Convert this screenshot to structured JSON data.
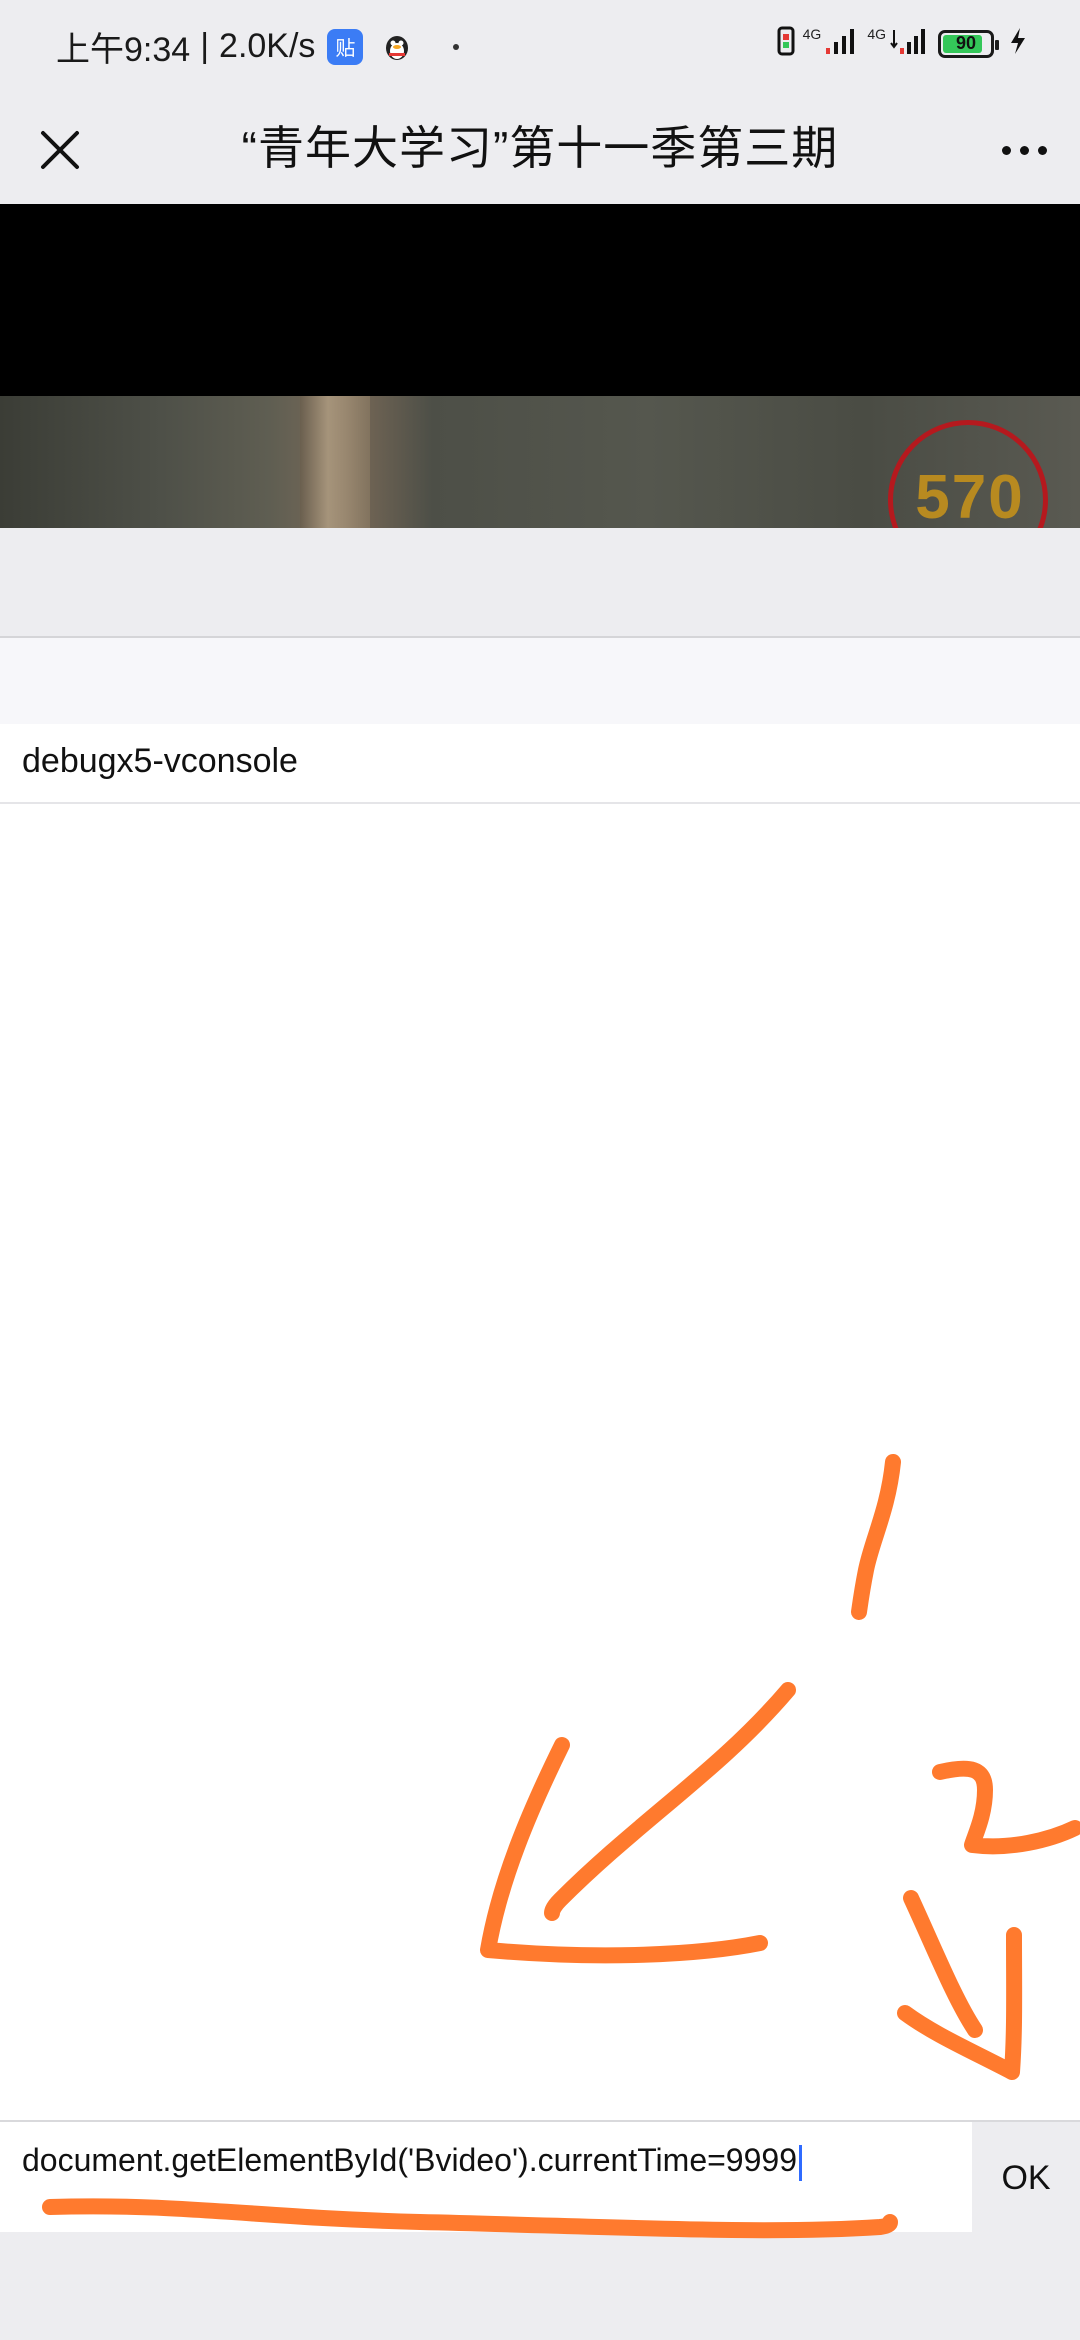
{
  "status_bar": {
    "time": "上午9:34",
    "separator": "|",
    "network_speed": "2.0K/s",
    "app_badge_char": "贴",
    "signal_1_label": "4G",
    "signal_2_label": "4G",
    "battery_percent": "90",
    "battery_level": 0.9,
    "battery_color": "#34c759"
  },
  "title_bar": {
    "title": "“青年大学习”第十一季第三期",
    "close_icon": "close-icon",
    "more_icon": "more-dots-icon"
  },
  "video": {
    "timer_text": "570",
    "timer_ring_color": "#b5191e"
  },
  "console": {
    "item_label": "debugx5-vconsole",
    "input_value": "document.getElementById('Bvideo').currentTime=9999",
    "ok_label": "OK",
    "caret_color": "#2f6bff"
  },
  "annotations": {
    "color": "#ff7a2e",
    "mark_1": "1",
    "mark_2": "2"
  }
}
